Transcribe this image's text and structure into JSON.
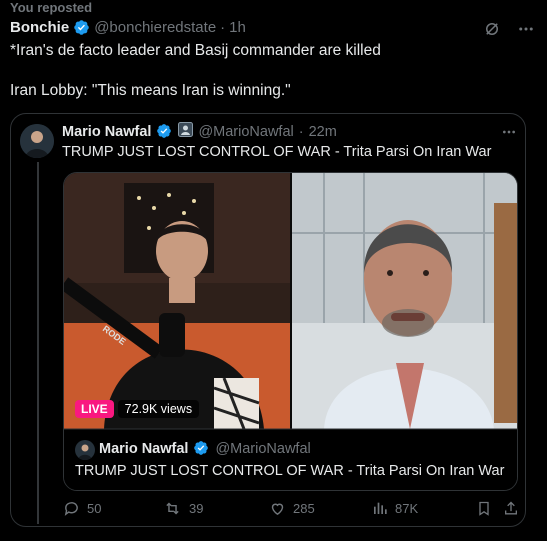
{
  "repost": {
    "label": "You reposted"
  },
  "post": {
    "author_name": "Bonchie",
    "handle": "@bonchieredstate",
    "sep": "·",
    "time": "1h",
    "line1": "*Iran's de facto leader and Basij commander are killed",
    "line2": "Iran Lobby: \"This means Iran is winning.\""
  },
  "quote": {
    "author_name": "Mario Nawfal",
    "handle": "@MarioNawfal",
    "sep": "·",
    "time": "22m",
    "text": "TRUMP JUST LOST CONTROL OF WAR - Trita Parsi On Iran War",
    "media": {
      "live_label": "LIVE",
      "views": "72.9K views"
    },
    "inner": {
      "author_name": "Mario Nawfal",
      "handle": "@MarioNawfal",
      "text": "TRUMP JUST LOST CONTROL OF WAR - Trita Parsi On Iran War"
    }
  },
  "actions": {
    "replies": "50",
    "reposts": "39",
    "likes": "285",
    "views": "87K"
  },
  "colors": {
    "verified": "#1d9bf0",
    "repost_active": "#00ba7c",
    "live": "#f91880",
    "muted": "#71767b"
  }
}
